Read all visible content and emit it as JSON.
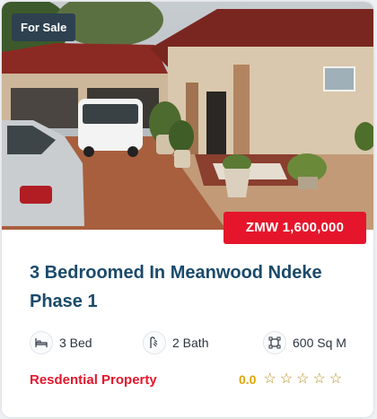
{
  "listing": {
    "status_badge": "For Sale",
    "price": "ZMW 1,600,000",
    "title": "3 Bedroomed In Meanwood Ndeke Phase 1",
    "features": {
      "beds": "3 Bed",
      "baths": "2 Bath",
      "area": "600 Sq M"
    },
    "property_type": "Resdential Property",
    "rating": {
      "score": "0.0",
      "stars_filled": 0,
      "stars_total": 5
    }
  },
  "icons": [
    "bed-icon",
    "bath-icon",
    "area-icon",
    "star-icon"
  ],
  "colors": {
    "badge_dark": "#2d4150",
    "price_red": "#e5162b",
    "title_blue": "#1a4a6b",
    "rating_gold": "#e0a400"
  }
}
